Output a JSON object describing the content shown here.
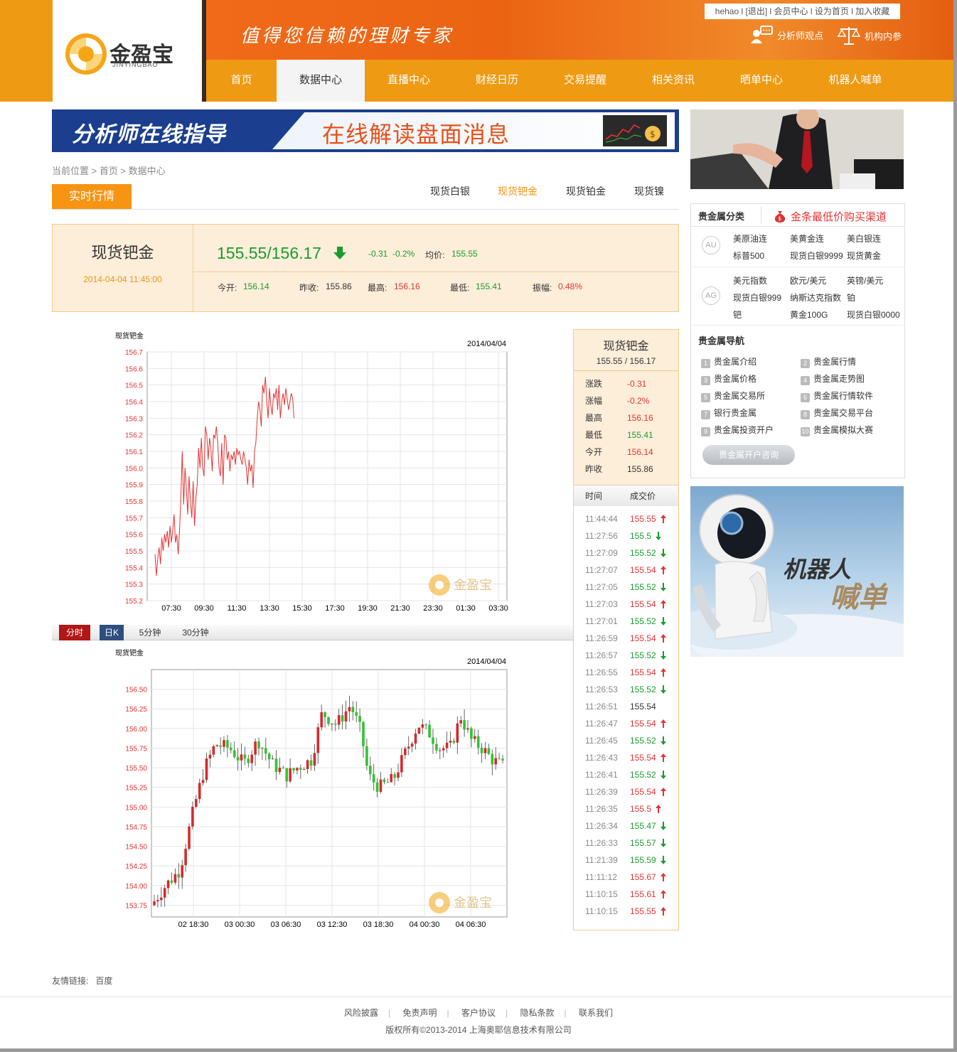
{
  "header": {
    "logo_text": "金盈宝",
    "logo_sub": "JINYINGBAO",
    "slogan": "值得您信赖的理财专家",
    "toplinks": [
      "hehao",
      "[退出]",
      "会员中心",
      "设为首页",
      "加入收藏"
    ],
    "features": [
      {
        "icon": "analyst-chat-icon",
        "label": "分析师观点"
      },
      {
        "icon": "scale-icon",
        "label": "机构内参"
      }
    ],
    "nav": [
      {
        "label": "首页",
        "active": false
      },
      {
        "label": "数据中心",
        "active": true
      },
      {
        "label": "直播中心",
        "active": false
      },
      {
        "label": "财经日历",
        "active": false
      },
      {
        "label": "交易提醒",
        "active": false
      },
      {
        "label": "相关资讯",
        "active": false
      },
      {
        "label": "晒单中心",
        "active": false
      },
      {
        "label": "机器人喊单",
        "active": false
      }
    ]
  },
  "banner": {
    "left": "分析师在线指导",
    "right": "在线解读盘面消息"
  },
  "breadcrumb": {
    "text": "当前位置 > 首页 > 数据中心"
  },
  "tabs": {
    "main": "实时行情",
    "sub": [
      {
        "label": "现货白银",
        "active": false
      },
      {
        "label": "现货钯金",
        "active": true
      },
      {
        "label": "现货铂金",
        "active": false
      },
      {
        "label": "现货镍",
        "active": false
      }
    ]
  },
  "quote": {
    "name": "现货钯金",
    "datetime": "2014-04-04 11:45:00",
    "price": "155.55/156.17",
    "change": "-0.31",
    "change_pct": "-0.2%",
    "avg_label": "均价:",
    "avg": "155.55",
    "open_label": "今开:",
    "open": "156.14",
    "prev_label": "昨收:",
    "prev": "155.86",
    "high_label": "最高:",
    "high": "156.16",
    "low_label": "最低:",
    "low": "155.41",
    "amp_label": "振幅:",
    "amp": "0.48%"
  },
  "chart_data": [
    {
      "type": "line",
      "title": "现货钯金",
      "date": "2014/04/04",
      "x_ticks": [
        "07:30",
        "09:30",
        "11:30",
        "13:30",
        "15:30",
        "17:30",
        "19:30",
        "21:30",
        "23:30",
        "01:30",
        "03:30"
      ],
      "y_ticks": [
        "156.7",
        "156.6",
        "156.5",
        "156.4",
        "156.3",
        "156.2",
        "156.1",
        "156.0",
        "155.9",
        "155.8",
        "155.7",
        "155.6",
        "155.5",
        "155.4",
        "155.3",
        "155.2"
      ],
      "ylim": [
        155.2,
        156.7
      ],
      "color": "#e53333",
      "series_minutes_from_0630": [
        0,
        5,
        10,
        15,
        20,
        25,
        30,
        35,
        40,
        45,
        50,
        55,
        60,
        65,
        70,
        75,
        80,
        85,
        90,
        95,
        100,
        105,
        110,
        115,
        120,
        125,
        130,
        135,
        140,
        145,
        150,
        155,
        160,
        165,
        170,
        175,
        180,
        185,
        190,
        195,
        200,
        205,
        210,
        215,
        220,
        225,
        230,
        235,
        240,
        245,
        250,
        255,
        260,
        265,
        270,
        275,
        280,
        285,
        290,
        295,
        300,
        305,
        310,
        315,
        320,
        325,
        330,
        335,
        340,
        345,
        350,
        355,
        360,
        365,
        370,
        375,
        380,
        385,
        390,
        395,
        400,
        405,
        410,
        415,
        420,
        425,
        430,
        435,
        440,
        445,
        450,
        455,
        460,
        465,
        470,
        475,
        480,
        485,
        490,
        495,
        500,
        505,
        510
      ],
      "values": [
        155.48,
        155.35,
        155.45,
        155.52,
        155.42,
        155.58,
        155.5,
        155.6,
        155.55,
        155.62,
        155.52,
        155.65,
        155.55,
        155.62,
        155.72,
        155.55,
        155.6,
        155.48,
        155.62,
        155.82,
        156.1,
        155.78,
        156.0,
        155.88,
        155.72,
        155.95,
        155.8,
        155.7,
        155.92,
        155.65,
        155.82,
        155.9,
        156.12,
        156.0,
        156.18,
        156.0,
        155.95,
        156.25,
        156.2,
        156.05,
        156.18,
        156.12,
        155.98,
        156.2,
        156.18,
        156.25,
        156.15,
        156.0,
        155.95,
        156.15,
        155.9,
        156.2,
        156.18,
        156.05,
        156.1,
        155.98,
        156.08,
        156.05,
        156.1,
        156.02,
        156.12,
        156.08,
        156.1,
        156.05,
        156.02,
        156.1,
        156.05,
        156.0,
        155.9,
        156.05,
        155.98,
        156.02,
        155.88,
        156.1,
        156.15,
        156.3,
        156.4,
        156.35,
        156.25,
        156.5,
        156.45,
        156.55,
        156.4,
        156.3,
        156.48,
        156.38,
        156.32,
        156.45,
        156.42,
        156.48,
        156.35,
        156.5,
        156.3,
        156.4,
        156.45,
        156.38,
        156.48,
        156.42,
        156.35,
        156.4,
        156.45,
        156.42,
        156.3
      ]
    },
    {
      "type": "candlestick",
      "title": "现货钯金",
      "date": "2014/04/04",
      "x_ticks": [
        "02 18:30",
        "03 00:30",
        "03 06:30",
        "03 12:30",
        "03 18:30",
        "04 00:30",
        "04 06:30"
      ],
      "y_ticks": [
        "156.50",
        "156.25",
        "156.00",
        "155.75",
        "155.50",
        "155.25",
        "155.00",
        "154.75",
        "154.50",
        "154.25",
        "154.00",
        "153.75"
      ],
      "ylim": [
        153.6,
        156.75
      ],
      "up_color": "#d62a2a",
      "down_color": "#2ec52e"
    }
  ],
  "period_tabs": [
    {
      "label": "分时",
      "active": "red"
    },
    {
      "label": "日K",
      "active": "blue"
    },
    {
      "label": "5分钟",
      "active": ""
    },
    {
      "label": "30分钟",
      "active": ""
    }
  ],
  "ticker": {
    "name": "现货钯金",
    "price": "155.55 / 156.17",
    "stats": [
      {
        "k": "涨跌",
        "v": "-0.31",
        "c": "red"
      },
      {
        "k": "涨幅",
        "v": "-0.2%",
        "c": "red"
      },
      {
        "k": "最高",
        "v": "156.16",
        "c": "red"
      },
      {
        "k": "最低",
        "v": "155.41",
        "c": "green"
      },
      {
        "k": "今开",
        "v": "156.14",
        "c": "red"
      },
      {
        "k": "昨收",
        "v": "155.86",
        "c": ""
      }
    ],
    "col_time": "时间",
    "col_price": "成交价",
    "ticks": [
      {
        "t": "11:44:44",
        "p": "155.55",
        "d": "up"
      },
      {
        "t": "11:27:56",
        "p": "155.5",
        "d": "down"
      },
      {
        "t": "11:27:09",
        "p": "155.52",
        "d": "down"
      },
      {
        "t": "11:27:07",
        "p": "155.54",
        "d": "up"
      },
      {
        "t": "11:27:05",
        "p": "155.52",
        "d": "down"
      },
      {
        "t": "11:27:03",
        "p": "155.54",
        "d": "up"
      },
      {
        "t": "11:27:01",
        "p": "155.52",
        "d": "down"
      },
      {
        "t": "11:26:59",
        "p": "155.54",
        "d": "up"
      },
      {
        "t": "11:26:57",
        "p": "155.52",
        "d": "down"
      },
      {
        "t": "11:26:55",
        "p": "155.54",
        "d": "up"
      },
      {
        "t": "11:26:53",
        "p": "155.52",
        "d": "down"
      },
      {
        "t": "11:26:51",
        "p": "155.54",
        "d": ""
      },
      {
        "t": "11:26:47",
        "p": "155.54",
        "d": "up"
      },
      {
        "t": "11:26:45",
        "p": "155.52",
        "d": "down"
      },
      {
        "t": "11:26:43",
        "p": "155.54",
        "d": "up"
      },
      {
        "t": "11:26:41",
        "p": "155.52",
        "d": "down"
      },
      {
        "t": "11:26:39",
        "p": "155.54",
        "d": "up"
      },
      {
        "t": "11:26:35",
        "p": "155.5",
        "d": "up"
      },
      {
        "t": "11:26:34",
        "p": "155.47",
        "d": "down"
      },
      {
        "t": "11:26:33",
        "p": "155.57",
        "d": "down"
      },
      {
        "t": "11:21:39",
        "p": "155.59",
        "d": "down"
      },
      {
        "t": "11:11:12",
        "p": "155.67",
        "d": "up"
      },
      {
        "t": "11:10:15",
        "p": "155.61",
        "d": "up"
      },
      {
        "t": "11:10:15",
        "p": "155.55",
        "d": "up"
      }
    ]
  },
  "right": {
    "metal_title": "贵金属分类",
    "buy_link": "金条最低价购买渠道",
    "au_badge": "AU",
    "ag_badge": "AG",
    "au_links": [
      "美原油连",
      "美黄金连",
      "美白银连",
      "标普500",
      "现货白银9999",
      "现货黄金"
    ],
    "ag_links": [
      "美元指数",
      "欧元/美元",
      "英镑/美元",
      "现货白银999",
      "纳斯达克指数",
      "铂",
      "钯",
      "黄金100G",
      "现货白银0000"
    ],
    "nav_title": "贵金属导航",
    "nav_links": [
      "贵金属介绍",
      "贵金属行情",
      "贵金属价格",
      "贵金属走势图",
      "贵金属交易所",
      "贵金属行情软件",
      "银行贵金属",
      "贵金属交易平台",
      "贵金属投资开户",
      "贵金属模拟大赛"
    ],
    "consult_button": "贵金属开户咨询",
    "robot_text_1": "机器人",
    "robot_text_2": "喊单"
  },
  "footer": {
    "friend_label": "友情链接:",
    "friend_link": "百度",
    "links": [
      "风险披露",
      "免责声明",
      "客户协议",
      "隐私条款",
      "联系我们"
    ],
    "copyright": "版权所有©2013-2014 上海奥耶信息技术有限公司"
  }
}
